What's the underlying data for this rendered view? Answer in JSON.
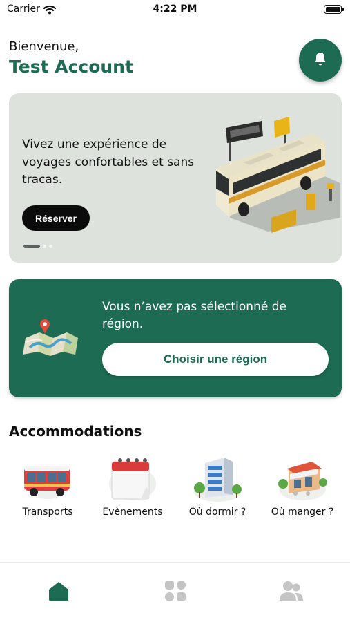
{
  "status_bar": {
    "carrier": "Carrier",
    "time": "4:22 PM",
    "icons": [
      "wifi-icon",
      "battery-icon"
    ]
  },
  "header": {
    "greeting": "Bienvenue,",
    "user_name": "Test Account",
    "notification_icon": "bell-icon"
  },
  "hero": {
    "text": "Vivez une expérience de voyages confortables et sans tracas.",
    "button_label": "Réserver",
    "carousel_index": 1,
    "carousel_count": 3,
    "image": "bus-station-illustration"
  },
  "region": {
    "message": "Vous n’avez pas sélectionné de région.",
    "button_label": "Choisir une région",
    "image": "map-pin-illustration"
  },
  "accommodations": {
    "title": "Accommodations",
    "items": [
      {
        "label": "Transports",
        "icon": "bus-icon"
      },
      {
        "label": "Evènements",
        "icon": "calendar-icon"
      },
      {
        "label": "Où dormir ?",
        "icon": "hotel-icon"
      },
      {
        "label": "Où manger ?",
        "icon": "restaurant-icon"
      }
    ]
  },
  "tabbar": {
    "tabs": [
      {
        "icon": "home-icon",
        "active": true
      },
      {
        "icon": "grid-icon",
        "active": false
      },
      {
        "icon": "users-icon",
        "active": false
      }
    ]
  },
  "colors": {
    "brand": "#1d6b52",
    "hero_background": "#dde2dd",
    "button_dark": "#0b0b0b",
    "inactive_icon": "#c5c5c5"
  }
}
